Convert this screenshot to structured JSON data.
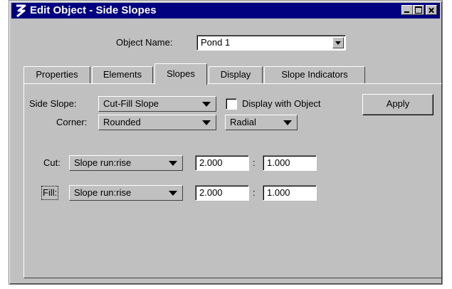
{
  "window": {
    "title": "Edit Object - Side Slopes"
  },
  "object_name": {
    "label": "Object Name:",
    "value": "Pond 1"
  },
  "tabs": [
    {
      "label": "Properties"
    },
    {
      "label": "Elements"
    },
    {
      "label": "Slopes"
    },
    {
      "label": "Display"
    },
    {
      "label": "Slope Indicators"
    }
  ],
  "active_tab": "Slopes",
  "side_slope": {
    "label": "Side Slope:",
    "value": "Cut-Fill Slope"
  },
  "display_with_object": {
    "label": "Display with Object",
    "checked": false
  },
  "apply_label": "Apply",
  "corner": {
    "label": "Corner:",
    "value": "Rounded",
    "method": "Radial"
  },
  "cut": {
    "label": "Cut:",
    "method": "Slope run:rise",
    "run": "2.000",
    "separator": ":",
    "rise": "1.000"
  },
  "fill": {
    "label": "Fill:",
    "method": "Slope run:rise",
    "run": "2.000",
    "separator": ":",
    "rise": "1.000"
  }
}
